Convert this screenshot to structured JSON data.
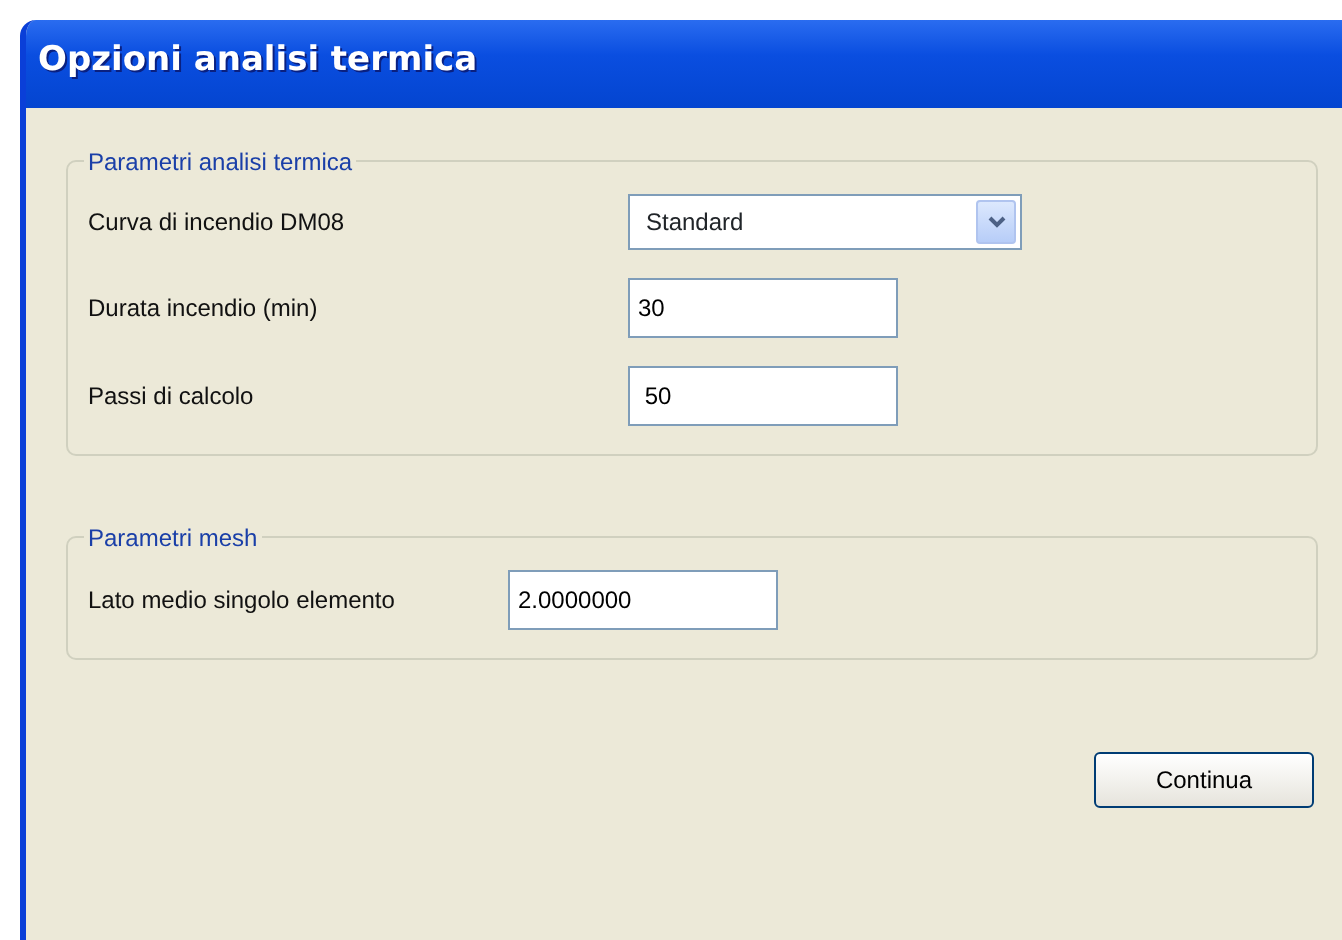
{
  "window": {
    "title": "Opzioni analisi termica"
  },
  "groups": [
    {
      "legend": "Parametri analisi termica",
      "fields": [
        {
          "kind": "combo",
          "label": "Curva di incendio DM08",
          "value": "Standard"
        },
        {
          "kind": "text",
          "label": "Durata incendio (min)",
          "value": "30"
        },
        {
          "kind": "text",
          "label": "Passi di calcolo",
          "value": " 50"
        }
      ]
    },
    {
      "legend": "Parametri mesh",
      "fields": [
        {
          "kind": "text",
          "label": "Lato medio singolo elemento",
          "value": "2.0000000"
        }
      ]
    }
  ],
  "buttons": [
    "Continua"
  ]
}
